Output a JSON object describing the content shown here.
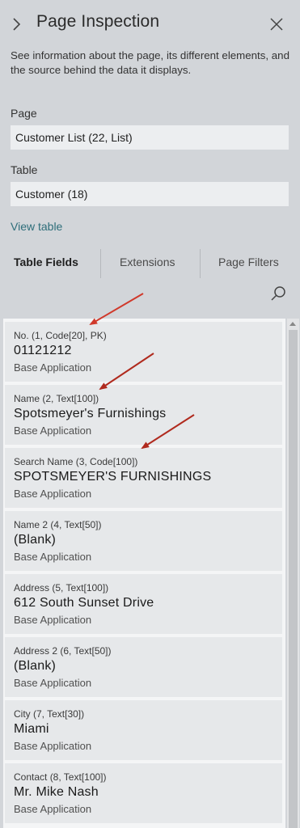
{
  "panel": {
    "title": "Page Inspection",
    "description": "See information about the page, its different elements, and the source behind the data it displays."
  },
  "page": {
    "label": "Page",
    "value": "Customer List (22, List)"
  },
  "table": {
    "label": "Table",
    "value": "Customer (18)"
  },
  "view_table_label": "View table",
  "tabs": [
    {
      "label": "Table Fields",
      "active": true
    },
    {
      "label": "Extensions",
      "active": false
    },
    {
      "label": "Page Filters",
      "active": false
    }
  ],
  "fields": [
    {
      "meta": "No. (1, Code[20], PK)",
      "value": "01121212",
      "source": "Base Application"
    },
    {
      "meta": "Name (2, Text[100])",
      "value": "Spotsmeyer's Furnishings",
      "source": "Base Application"
    },
    {
      "meta": "Search Name (3, Code[100])",
      "value": "SPOTSMEYER'S FURNISHINGS",
      "source": "Base Application"
    },
    {
      "meta": "Name 2 (4, Text[50])",
      "value": "(Blank)",
      "source": "Base Application"
    },
    {
      "meta": "Address (5, Text[100])",
      "value": "612 South Sunset Drive",
      "source": "Base Application"
    },
    {
      "meta": "Address 2 (6, Text[50])",
      "value": "(Blank)",
      "source": "Base Application"
    },
    {
      "meta": "City (7, Text[30])",
      "value": "Miami",
      "source": "Base Application"
    },
    {
      "meta": "Contact (8, Text[100])",
      "value": "Mr. Mike Nash",
      "source": "Base Application"
    }
  ],
  "colors": {
    "panel_bg": "#d2d5d9",
    "field_bg": "#eceef0",
    "link": "#2e6e7a",
    "annotation_arrow": "#d0392b"
  },
  "icons": [
    "chevron-right-icon",
    "close-icon",
    "search-icon"
  ]
}
